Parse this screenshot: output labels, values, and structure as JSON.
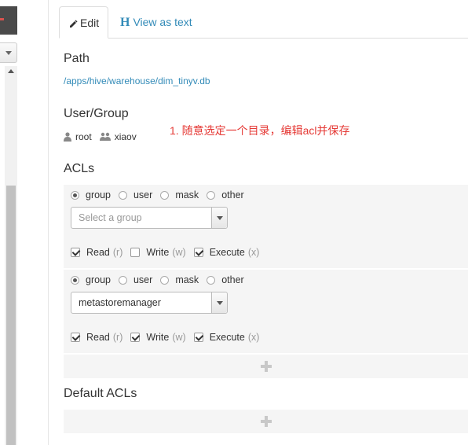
{
  "tabs": {
    "edit": "Edit",
    "view_text_icon": "H",
    "view_text": "View as text"
  },
  "path": {
    "heading": "Path",
    "value": "/apps/hive/warehouse/dim_tinyv.db"
  },
  "user_group": {
    "heading": "User/Group",
    "user": "root",
    "group": "xiaov"
  },
  "annotation": "1. 随意选定一个目录，编辑acl并保存",
  "acls": {
    "heading": "ACLs",
    "entries": [
      {
        "types": [
          "group",
          "user",
          "mask",
          "other"
        ],
        "selected_type": "group",
        "select_placeholder": "Select a group",
        "select_value": "",
        "perms": [
          {
            "label": "Read",
            "code": "(r)",
            "checked": true
          },
          {
            "label": "Write",
            "code": "(w)",
            "checked": false
          },
          {
            "label": "Execute",
            "code": "(x)",
            "checked": true
          }
        ]
      },
      {
        "types": [
          "group",
          "user",
          "mask",
          "other"
        ],
        "selected_type": "group",
        "select_placeholder": "",
        "select_value": "metastoremanager",
        "perms": [
          {
            "label": "Read",
            "code": "(r)",
            "checked": true
          },
          {
            "label": "Write",
            "code": "(w)",
            "checked": true
          },
          {
            "label": "Execute",
            "code": "(x)",
            "checked": true
          }
        ]
      }
    ]
  },
  "default_acls": {
    "heading": "Default ACLs"
  },
  "icons": {
    "edit": "pencil-icon",
    "view_text": "h-icon",
    "user": "user-icon",
    "group": "group-icon",
    "add": "plus-icon"
  },
  "colors": {
    "link": "#338bb8",
    "annotation": "#e53935",
    "panel_bg": "#f5f5f5"
  }
}
